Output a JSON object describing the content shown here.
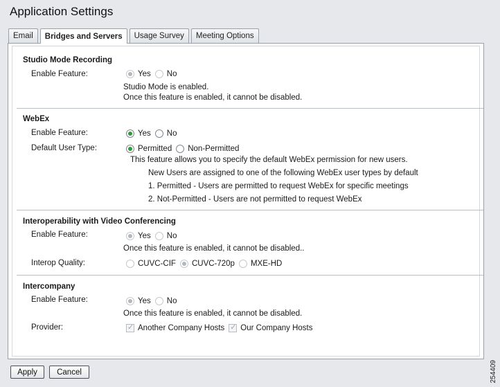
{
  "app_title": "Application Settings",
  "tabs": [
    {
      "label": "Email",
      "active": false
    },
    {
      "label": "Bridges and Servers",
      "active": true
    },
    {
      "label": "Usage Survey",
      "active": false
    },
    {
      "label": "Meeting Options",
      "active": false
    }
  ],
  "studio": {
    "title": "Studio Mode Recording",
    "enable_label": "Enable Feature:",
    "yes": "Yes",
    "no": "No",
    "note1": "Studio Mode is enabled.",
    "note2": "Once this feature is enabled, it cannot be disabled."
  },
  "webex": {
    "title": "WebEx",
    "enable_label": "Enable Feature:",
    "yes": "Yes",
    "no": "No",
    "user_type_label": "Default User Type:",
    "permitted": "Permitted",
    "non_permitted": "Non-Permitted",
    "desc1": "This feature allows you to specify the default WebEx permission for new users.",
    "desc2": "New Users are assigned to one of the following WebEx user types by default",
    "desc3": "1. Permitted - Users are permitted to request WebEx for specific meetings",
    "desc4": "2. Not-Permitted - Users are not permitted to request WebEx"
  },
  "interop": {
    "title": "Interoperability with Video Conferencing",
    "enable_label": "Enable Feature:",
    "yes": "Yes",
    "no": "No",
    "note": "Once this feature is enabled, it cannot be disabled..",
    "quality_label": "Interop Quality:",
    "q1": "CUVC-CIF",
    "q2": "CUVC-720p",
    "q3": "MXE-HD"
  },
  "intercompany": {
    "title": "Intercompany",
    "enable_label": "Enable Feature:",
    "yes": "Yes",
    "no": "No",
    "note": "Once this feature is enabled, it cannot be disabled.",
    "provider_label": "Provider:",
    "p1": "Another Company Hosts",
    "p2": "Our Company Hosts"
  },
  "buttons": {
    "apply": "Apply",
    "cancel": "Cancel"
  },
  "figure_number": "254409",
  "colors": {
    "radio_checked": "#2f9a3a",
    "background": "#e6e8eb"
  }
}
